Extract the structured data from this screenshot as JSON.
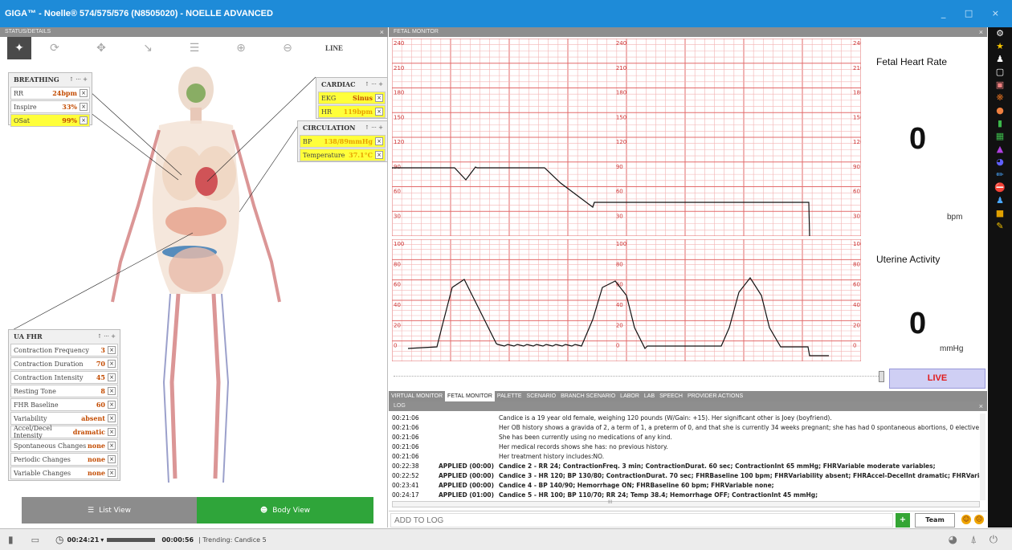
{
  "window": {
    "title": "GIGA™ - Noelle® 574/575/576 (N8505020) - NOELLE ADVANCED",
    "controls": "_ □ ×"
  },
  "left_panel": {
    "header": "STATUS/DETAILS",
    "close": "×",
    "toolbar": {
      "line": "LINE"
    }
  },
  "breathing": {
    "title": "BREATHING",
    "controls": "↑ ··· +",
    "rows": [
      {
        "label": "RR",
        "value": "24bpm"
      },
      {
        "label": "Inspire",
        "value": "33%"
      },
      {
        "label": "OSat",
        "value": "99%"
      }
    ]
  },
  "cardiac": {
    "title": "CARDIAC",
    "controls": "↑ ··· +",
    "rows": [
      {
        "label": "EKG",
        "value": "Sinus"
      },
      {
        "label": "HR",
        "value": "119bpm"
      }
    ]
  },
  "circulation": {
    "title": "CIRCULATION",
    "controls": "↑ ··· +",
    "rows": [
      {
        "label": "BP",
        "value": "138/89mmHg"
      },
      {
        "label": "Temperature",
        "value": "37.1°C"
      }
    ]
  },
  "uafhr": {
    "title": "UA FHR",
    "controls": "↑ ··· +",
    "rows": [
      {
        "label": "Contraction Frequency",
        "value": "3"
      },
      {
        "label": "Contraction Duration",
        "value": "70"
      },
      {
        "label": "Contraction Intensity",
        "value": "45"
      },
      {
        "label": "Resting Tone",
        "value": "8"
      },
      {
        "label": "FHR Baseline",
        "value": "60"
      },
      {
        "label": "Variability",
        "value": "absent"
      },
      {
        "label": "Accel/Decel Intensity",
        "value": "dramatic"
      },
      {
        "label": "Spontaneous Changes",
        "value": "none"
      },
      {
        "label": "Periodic Changes",
        "value": "none"
      },
      {
        "label": "Variable Changes",
        "value": "none"
      }
    ]
  },
  "x_label": "×",
  "view_buttons": {
    "list": "List View",
    "body": "Body View"
  },
  "fetal_monitor": {
    "header": "FETAL MONITOR",
    "close": "×",
    "fhr_label": "Fetal Heart Rate",
    "fhr_value": "0",
    "fhr_unit": "bpm",
    "ua_label": "Uterine Activity",
    "ua_value": "0",
    "ua_unit": "mmHg",
    "live": "LIVE",
    "fhr_ticks": [
      "240",
      "210",
      "180",
      "150",
      "120",
      "90",
      "60",
      "30"
    ],
    "ua_ticks": [
      "100",
      "80",
      "60",
      "40",
      "20",
      "0"
    ]
  },
  "tabs": [
    "VIRTUAL MONITOR",
    "FETAL MONITOR",
    "PALETTE",
    "SCENARIO",
    "BRANCH SCENARIO",
    "LABOR",
    "LAB",
    "SPEECH",
    "PROVIDER ACTIONS"
  ],
  "log": {
    "header": "LOG",
    "close": "×",
    "rows": [
      {
        "time": "00:21:06",
        "applied": "",
        "msg": "Candice is a 19 year old female, weighing 120 pounds (W/Gain: +15).  Her significant other is Joey (boyfriend)."
      },
      {
        "time": "00:21:06",
        "applied": "",
        "msg": "Her OB history shows a gravida of 2, a term of 1, a preterm of 0, and that she is currently 34 weeks pregnant; she has had 0 spontaneous abortions, 0 elective abortic"
      },
      {
        "time": "00:21:06",
        "applied": "",
        "msg": "She has been currently using no medications of any kind."
      },
      {
        "time": "00:21:06",
        "applied": "",
        "msg": "Her medical records shows she has: no previous history."
      },
      {
        "time": "00:21:06",
        "applied": "",
        "msg": "Her treatment history includes:NO."
      },
      {
        "time": "00:22:38",
        "applied": "APPLIED (00:00)",
        "msg": "Candice 2 - RR 24; ContractionFreq. 3 min; ContractionDurat. 60 sec; ContractionInt 65 mmHg; FHRVariable moderate variables;"
      },
      {
        "time": "00:22:52",
        "applied": "APPLIED (00:00)",
        "msg": "Candice 3 - HR 120; BP 130/80; ContractionDurat. 70 sec; FHRBaseline 100 bpm; FHRVariability absent; FHRAccel-DecelInt dramatic; FHRVariable seve"
      },
      {
        "time": "00:23:41",
        "applied": "APPLIED (00:00)",
        "msg": "Candice 4 - BP 140/90; Hemorrhage ON; FHRBaseline 60 bpm; FHRVariable none;"
      },
      {
        "time": "00:24:17",
        "applied": "APPLIED (01:00)",
        "msg": "Candice 5 - HR 100; BP 110/70; RR 24; Temp 38.4; Hemorrhage OFF; ContractionInt 45 mmHg;"
      }
    ],
    "scroll_mark": "III"
  },
  "addlog": {
    "placeholder": "ADD TO LOG",
    "plus": "+",
    "team": "Team"
  },
  "status": {
    "elapsed": "00:24:21",
    "remaining": "00:00:56",
    "trending": "| Trending: Candice 5"
  }
}
